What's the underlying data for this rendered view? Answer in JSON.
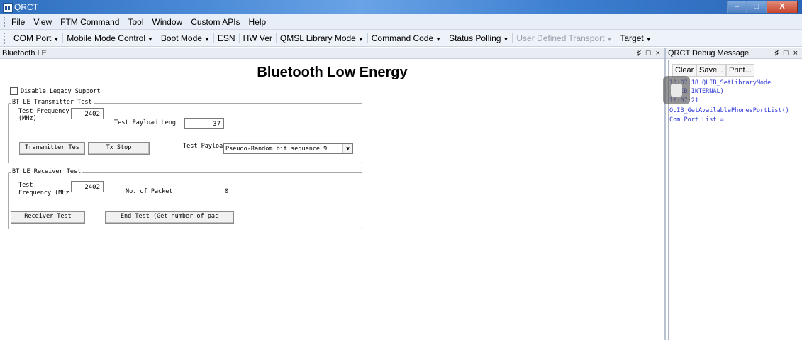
{
  "app": {
    "title": "QRCT"
  },
  "window_controls": {
    "minimize": "–",
    "maximize": "□",
    "close": "X"
  },
  "menu": [
    "File",
    "View",
    "FTM Command",
    "Tool",
    "Window",
    "Custom APIs",
    "Help"
  ],
  "toolbar": [
    {
      "label": "COM Port",
      "dropdown": true
    },
    {
      "label": "Mobile Mode Control",
      "dropdown": true
    },
    {
      "label": "Boot Mode",
      "dropdown": true
    },
    {
      "label": "ESN",
      "dropdown": false
    },
    {
      "label": "HW Ver",
      "dropdown": false
    },
    {
      "label": "QMSL Library Mode",
      "dropdown": true
    },
    {
      "label": "Command Code",
      "dropdown": true
    },
    {
      "label": "Status Polling",
      "dropdown": true
    },
    {
      "label": "User Defined Transport",
      "dropdown": true,
      "disabled": true
    },
    {
      "label": "Target",
      "dropdown": true
    }
  ],
  "left_panel": {
    "header": "Bluetooth LE",
    "header_controls": "♯ □ ×",
    "title": "Bluetooth Low Energy",
    "disable_legacy_label": "Disable Legacy Support",
    "transmitter": {
      "group_title": "BT LE Transmitter Test",
      "freq_label_1": "Test Frequency",
      "freq_label_2": "(MHz)",
      "freq_value": "2402",
      "payload_len_label": "Test Payload Leng",
      "payload_len_value": "37",
      "tx_button": "Transmitter Tes",
      "tx_stop_button": "Tx Stop",
      "payload_label": "Test Payloa",
      "payload_selected": "Pseudo-Random bit sequence 9"
    },
    "receiver": {
      "group_title": "BT LE Receiver Test",
      "freq_label_1": "Test",
      "freq_label_2": "Frequency (MHz",
      "freq_value": "2402",
      "packets_label": "No. of Packet",
      "packets_value": "0",
      "rx_button": "Receiver Test",
      "end_button": "End Test (Get number of pac"
    }
  },
  "debug_panel": {
    "header": "QRCT Debug Message",
    "header_controls": "♯ □ ×",
    "buttons": [
      "Clear",
      "Save...",
      "Print..."
    ],
    "lines": [
      "10:07:18  QLIB_SetLibraryMode",
      "(QLIB_INTERNAL)",
      "10:07:21",
      "QLIB_GetAvailablePhonesPortList()",
      "Com Port List ="
    ]
  }
}
